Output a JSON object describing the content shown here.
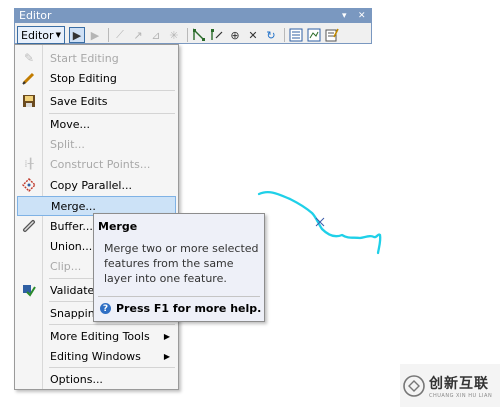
{
  "toolbar": {
    "title": "Editor",
    "editor_label": "Editor",
    "pin_glyph": "▾",
    "close_glyph": "✕"
  },
  "menu": {
    "items": [
      {
        "label": "Start Editing",
        "icon": "pencil-icon",
        "enabled": false
      },
      {
        "label": "Stop Editing",
        "icon": "pencil-stop-icon",
        "enabled": true
      },
      {
        "label": "Save Edits",
        "icon": "save-edits-icon",
        "enabled": true
      },
      {
        "label": "Move...",
        "icon": "",
        "enabled": true
      },
      {
        "label": "Split...",
        "icon": "",
        "enabled": false
      },
      {
        "label": "Construct Points...",
        "icon": "construct-points-icon",
        "enabled": false
      },
      {
        "label": "Copy Parallel...",
        "icon": "copy-parallel-icon",
        "enabled": true
      },
      {
        "label": "Merge...",
        "icon": "",
        "enabled": true,
        "highlighted": true
      },
      {
        "label": "Buffer...",
        "icon": "buffer-icon",
        "enabled": true
      },
      {
        "label": "Union...",
        "icon": "",
        "enabled": true
      },
      {
        "label": "Clip...",
        "icon": "",
        "enabled": false
      },
      {
        "label": "Validate",
        "icon": "validate-icon",
        "enabled": true
      },
      {
        "label": "Snapping",
        "icon": "",
        "enabled": true
      },
      {
        "label": "More Editing Tools",
        "icon": "",
        "enabled": true,
        "submenu": true
      },
      {
        "label": "Editing Windows",
        "icon": "",
        "enabled": true,
        "submenu": true
      },
      {
        "label": "Options...",
        "icon": "",
        "enabled": true
      }
    ]
  },
  "tooltip": {
    "title": "Merge",
    "body": "Merge two or more selected features from the same layer into one feature.",
    "help": "Press F1 for more help."
  },
  "watermark": {
    "cn": "创新互联",
    "en": "CHUANG XIN HU LIAN"
  },
  "colors": {
    "feature_line": "#1fd0e8",
    "highlight": "#cce2f7",
    "toolbar_title": "#7a98c0"
  }
}
